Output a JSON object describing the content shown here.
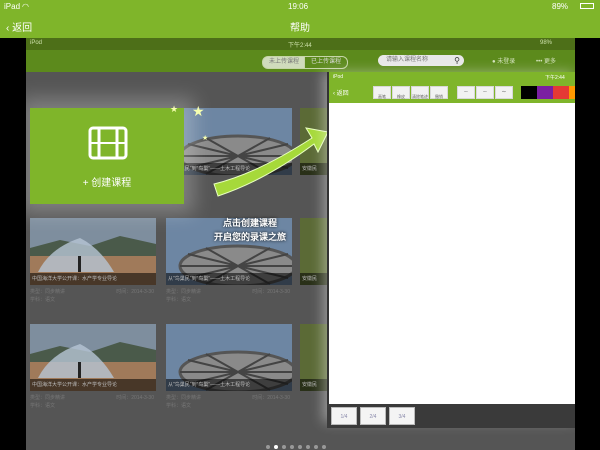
{
  "status_bar": {
    "device": "iPad",
    "time": "19:06",
    "battery": "89%"
  },
  "nav": {
    "back_label": "返回",
    "title": "帮助"
  },
  "inner": {
    "status": {
      "device": "iPod",
      "time": "下午2:44",
      "battery": "98%"
    },
    "tabs": [
      {
        "label": "未上传课程"
      },
      {
        "label": "已上传课程"
      }
    ],
    "search_placeholder": "请输入课程名称",
    "user_label": "未登录",
    "more_label": "更多"
  },
  "create_card": {
    "label": "+ 创建课程"
  },
  "hint": {
    "line1": "点击创建课程",
    "line2": "开启您的录课之旅"
  },
  "course_cards": [
    {
      "caption": "从\"鸟巢民\"到\"鸟巢\"——土木工程导论"
    },
    {
      "caption": "安徽民"
    },
    {
      "caption": "中国海洋大学公开课：水产学专业导论",
      "type": "类型：同步精讲",
      "date": "时间：2014-3-30",
      "subject": "学科：语文"
    },
    {
      "caption": "从\"鸟巢民\"到\"鸟巢\"——土木工程导论",
      "type": "类型：同步精讲",
      "date": "时间：2014-3-30",
      "subject": "学科：语文"
    },
    {
      "caption": "安徽民"
    },
    {
      "caption": "中国海洋大学公开课：水产学专业导论",
      "type": "类型：同步精讲",
      "date": "时间：2014-3-30",
      "subject": "学科：语文"
    },
    {
      "caption": "从\"鸟巢民\"到\"鸟巢\"——土木工程导论",
      "type": "类型：同步精讲",
      "date": "时间：2014-3-30",
      "subject": "学科：语文"
    },
    {
      "caption": "安徽民"
    }
  ],
  "sketch": {
    "status": {
      "device": "iPod",
      "time": "下午2:44"
    },
    "back_label": "返回",
    "tools": [
      "画笔",
      "橡皮",
      "清除笔迹",
      "撤销"
    ],
    "colors": [
      "#000000",
      "#7b1fa2",
      "#e53935",
      "#ff9800"
    ],
    "thumbs": [
      "1/4",
      "2/4",
      "3/4"
    ]
  },
  "pager": {
    "total": 8,
    "current": 2
  }
}
